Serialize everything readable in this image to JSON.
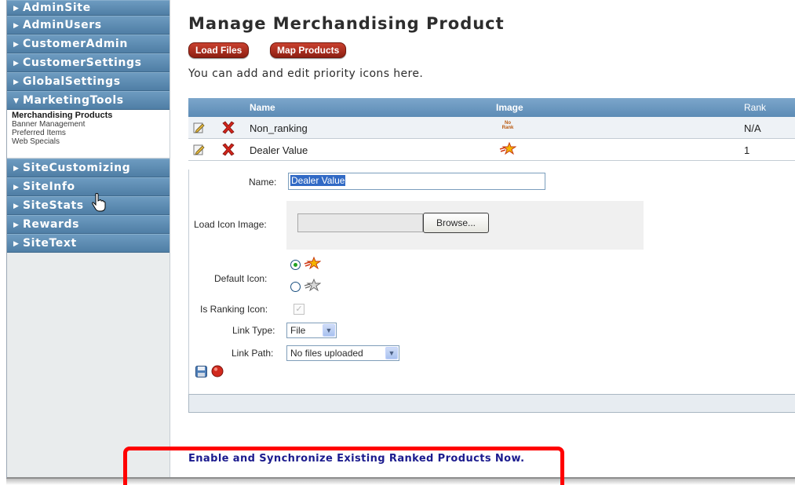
{
  "sidebar": {
    "items": [
      {
        "label": "AdminSite"
      },
      {
        "label": "AdminUsers"
      },
      {
        "label": "CustomerAdmin"
      },
      {
        "label": "CustomerSettings"
      },
      {
        "label": "GlobalSettings"
      },
      {
        "label": "MarketingTools"
      },
      {
        "label": "SiteCustomizing"
      },
      {
        "label": "SiteInfo"
      },
      {
        "label": "SiteStats"
      },
      {
        "label": "Rewards"
      },
      {
        "label": "SiteText"
      }
    ],
    "sub_items": [
      {
        "label": "Merchandising Products",
        "active": true
      },
      {
        "label": "Banner Management"
      },
      {
        "label": "Preferred Items"
      },
      {
        "label": "Web Specials"
      }
    ]
  },
  "main": {
    "title": "Manage Merchandising Product",
    "buttons": {
      "load_files": "Load Files",
      "map_products": "Map Products"
    },
    "intro": "You can add and edit priority icons here.",
    "grid": {
      "headers": {
        "name": "Name",
        "image": "Image",
        "rank": "Rank"
      },
      "rows": [
        {
          "name": "Non_ranking",
          "image": "No Rank",
          "rank": "N/A"
        },
        {
          "name": "Dealer Value",
          "image": "star-icon",
          "rank": "1"
        }
      ]
    },
    "form": {
      "name_label": "Name:",
      "name_value": "Dealer Value",
      "load_icon_label": "Load Icon Image:",
      "browse_label": "Browse...",
      "default_icon_label": "Default Icon:",
      "is_ranking_label": "Is Ranking Icon:",
      "link_type_label": "Link Type:",
      "link_type_value": "File",
      "link_path_label": "Link Path:",
      "link_path_value": "No files uploaded"
    },
    "sync_link": "Enable and Synchronize Existing Ranked Products Now."
  },
  "colors": {
    "nav_bg": "#5f8db3",
    "button_red": "#a32a1a",
    "header_blue": "#6a97c0",
    "highlight": "#ff0000",
    "link": "#1b1b8e"
  }
}
